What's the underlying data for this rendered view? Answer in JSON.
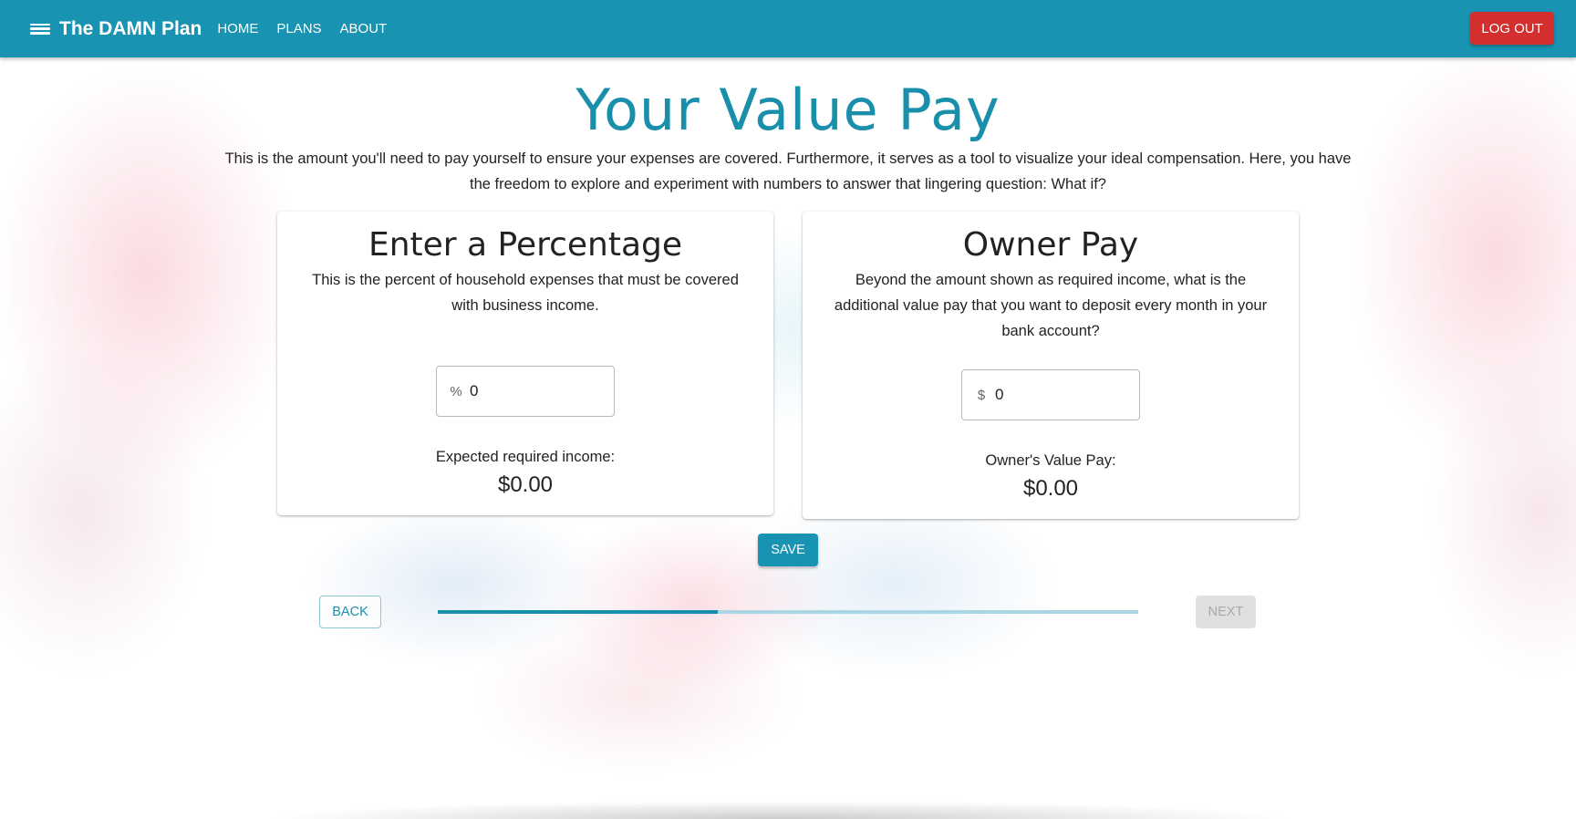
{
  "header": {
    "brand": "The DAMN Plan",
    "nav": [
      "HOME",
      "PLANS",
      "ABOUT"
    ],
    "logout_label": "LOG OUT",
    "icons": {
      "menu": "menu-icon"
    }
  },
  "page": {
    "title": "Your Value Pay",
    "intro": "This is the amount you'll need to pay yourself to ensure your expenses are covered. Furthermore, it serves as a tool to visualize your ideal compensation. Here, you have the freedom to explore and experiment with numbers to answer that lingering question: What if?"
  },
  "percentage_card": {
    "title": "Enter a Percentage",
    "description": "This is the percent of household expenses that must be covered with business income.",
    "input_prefix": "%",
    "input_value": "0",
    "result_label": "Expected required income:",
    "result_value": "$0.00"
  },
  "owner_card": {
    "title": "Owner Pay",
    "description": "Beyond the amount shown as required income, what is the additional value pay that you want to deposit every month in your bank account?",
    "input_prefix": "$",
    "input_value": "0",
    "result_label": "Owner's Value Pay:",
    "result_value": "$0.00"
  },
  "actions": {
    "save_label": "SAVE",
    "back_label": "BACK",
    "next_label": "NEXT",
    "next_disabled": true
  },
  "progress": {
    "fraction": 0.4
  },
  "colors": {
    "primary": "#1893b2",
    "title": "#1a8fab",
    "danger": "#d32f2f",
    "progress_track": "#a9d6e2"
  }
}
